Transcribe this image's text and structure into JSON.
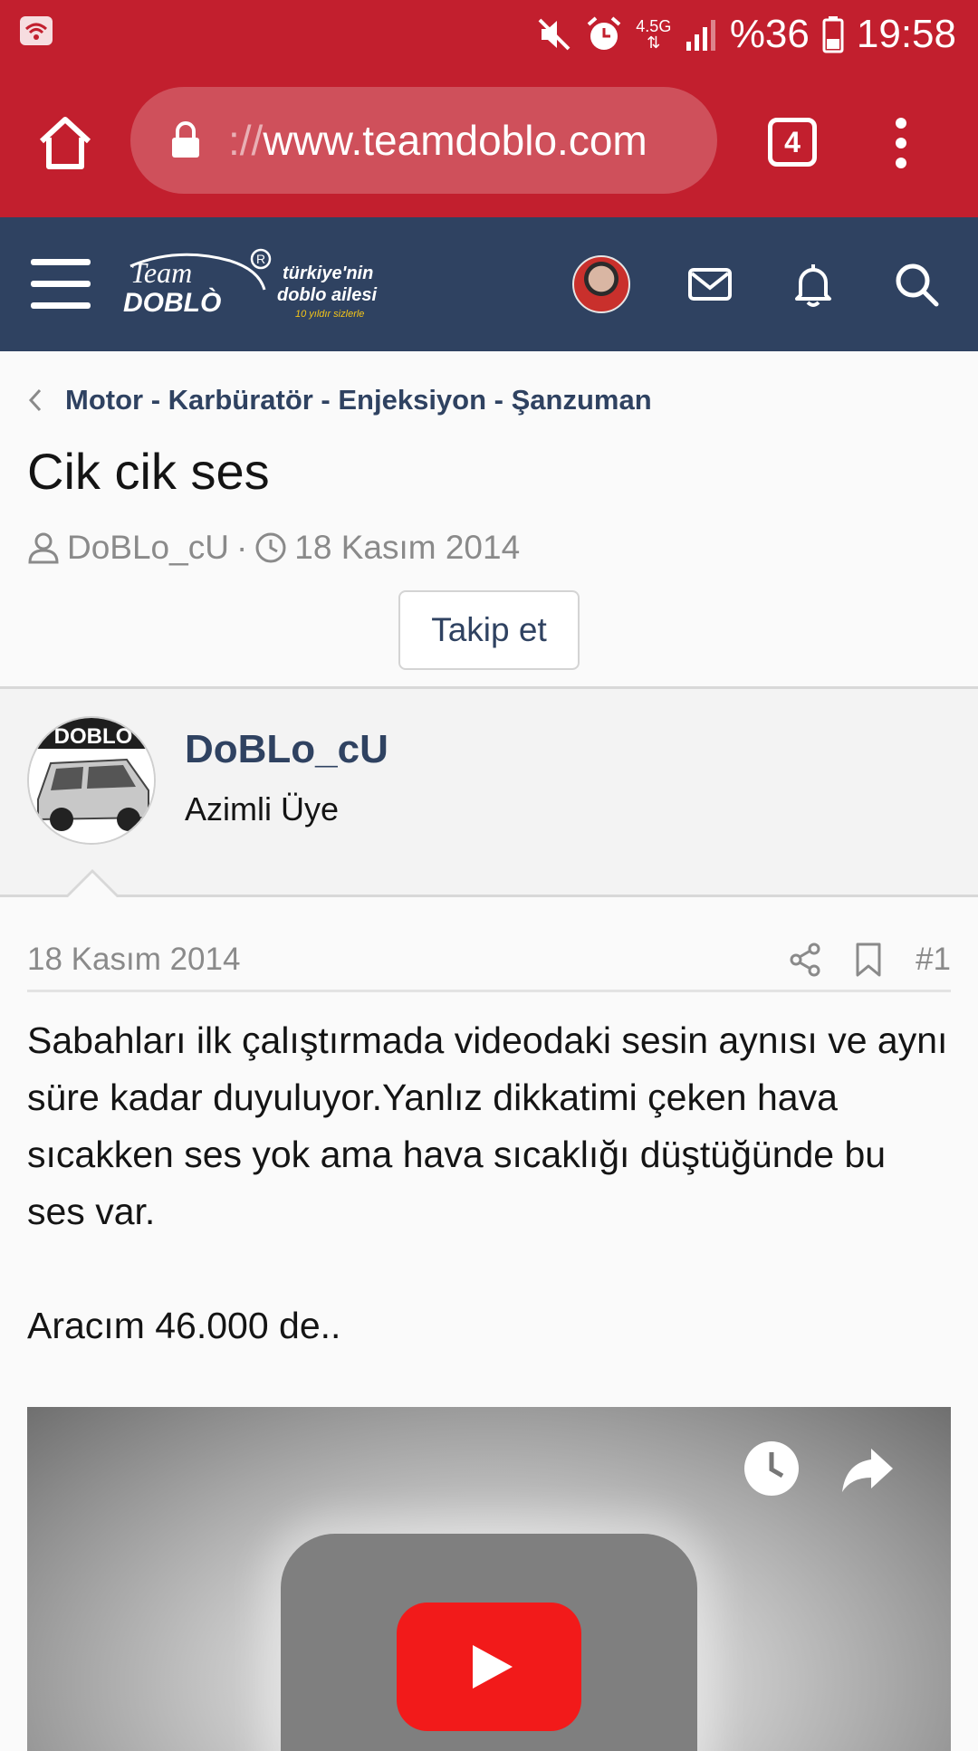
{
  "status_bar": {
    "network_type": "4.5G",
    "battery": "%36",
    "time": "19:58",
    "icons": [
      "wifi-calling-icon",
      "mute-icon",
      "alarm-icon",
      "signal-icon",
      "battery-icon"
    ]
  },
  "browser": {
    "url_scheme": "://",
    "url_host": "www.teamdoblo.com",
    "tab_count": "4",
    "accent_color": "#c21f2e"
  },
  "site_header": {
    "logo_line1": "Team",
    "logo_line2": "DOBLÒ",
    "logo_tagline1": "türkiye'nin",
    "logo_tagline2": "doblo ailesi",
    "logo_tagline3": "10 yıldır sizlerle",
    "bg_color": "#2f4261"
  },
  "thread": {
    "breadcrumb": "Motor - Karbüratör - Enjeksiyon - Şanzuman",
    "title": "Cik cik ses",
    "author": "DoBLo_cU",
    "separator": "·",
    "date": "18 Kasım 2014",
    "follow_label": "Takip et"
  },
  "post": {
    "user_name": "DoBLo_cU",
    "user_title": "Azimli Üye",
    "avatar_text": "DOBLO",
    "date": "18 Kasım 2014",
    "number": "#1",
    "body_paragraph1": "Sabahları ilk çalıştırmada videodaki sesin aynısı ve aynı süre kadar duyuluyor.Yanlız dikkatimi çeken hava sıcakken ses yok ama hava sıcaklığı düştüğünde bu ses var.",
    "body_paragraph2": "Aracım 46.000 de.."
  }
}
